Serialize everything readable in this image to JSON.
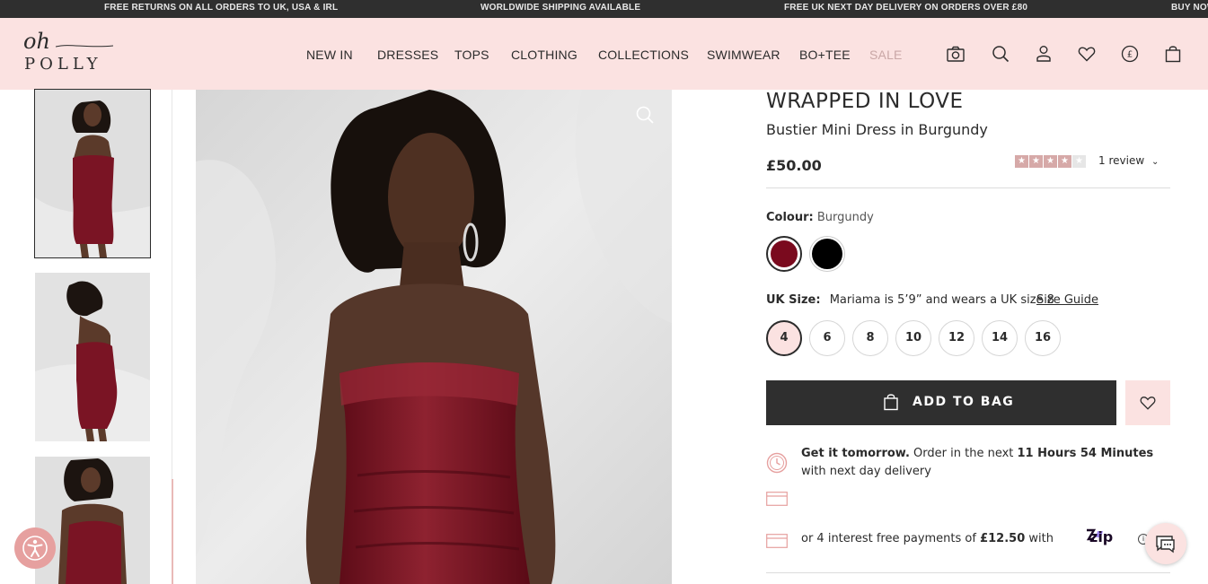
{
  "promo": {
    "messages": [
      "FREE RETURNS ON ALL ORDERS TO UK, USA & IRL",
      "WORLDWIDE SHIPPING AVAILABLE",
      "FREE UK NEXT DAY DELIVERY ON ORDERS OVER £80",
      "BUY NOW"
    ]
  },
  "header": {
    "logo_top": "oh",
    "logo_bottom": "POLLY",
    "nav": [
      "NEW IN",
      "DRESSES",
      "TOPS",
      "CLOTHING",
      "COLLECTIONS",
      "SWIMWEAR",
      "BO+TEE",
      "SALE"
    ],
    "icons": [
      "camera-icon",
      "search-icon",
      "account-icon",
      "wishlist-icon",
      "currency-icon",
      "bag-icon"
    ],
    "currency_symbol": "£"
  },
  "product": {
    "title": "WRAPPED IN LOVE",
    "subtitle": "Bustier Mini Dress in Burgundy",
    "price": "£50.00",
    "rating": 4,
    "rating_max": 5,
    "review_text": "1 review",
    "colour_label": "Colour:",
    "colour_value": "Burgundy",
    "colours": [
      {
        "name": "Burgundy",
        "hex": "#7a0a1e"
      },
      {
        "name": "Black",
        "hex": "#000000"
      }
    ],
    "size_label": "UK Size:",
    "size_note": "Mariama is 5’9” and wears a UK size 8",
    "size_guide": "Size Guide",
    "sizes": [
      "4",
      "6",
      "8",
      "10",
      "12",
      "14",
      "16"
    ],
    "selected_size": "4",
    "add_to_bag": "ADD TO BAG",
    "delivery_bold": "Get it tomorrow.",
    "delivery_mid": " Order in the next ",
    "delivery_time": "11 Hours 54 Minutes",
    "delivery_end": " with next day delivery",
    "pay_prefix": "or 4 interest free payments of ",
    "pay_amount": "£12.50",
    "pay_suffix": " with",
    "zip_label": "zip"
  },
  "colors": {
    "header_bg": "#fbe2e1",
    "promo_bg": "#2f2f2f",
    "accent_pink": "#e6a09f",
    "sale_text": "#c9a7a6",
    "burgundy": "#7a0a1e"
  }
}
